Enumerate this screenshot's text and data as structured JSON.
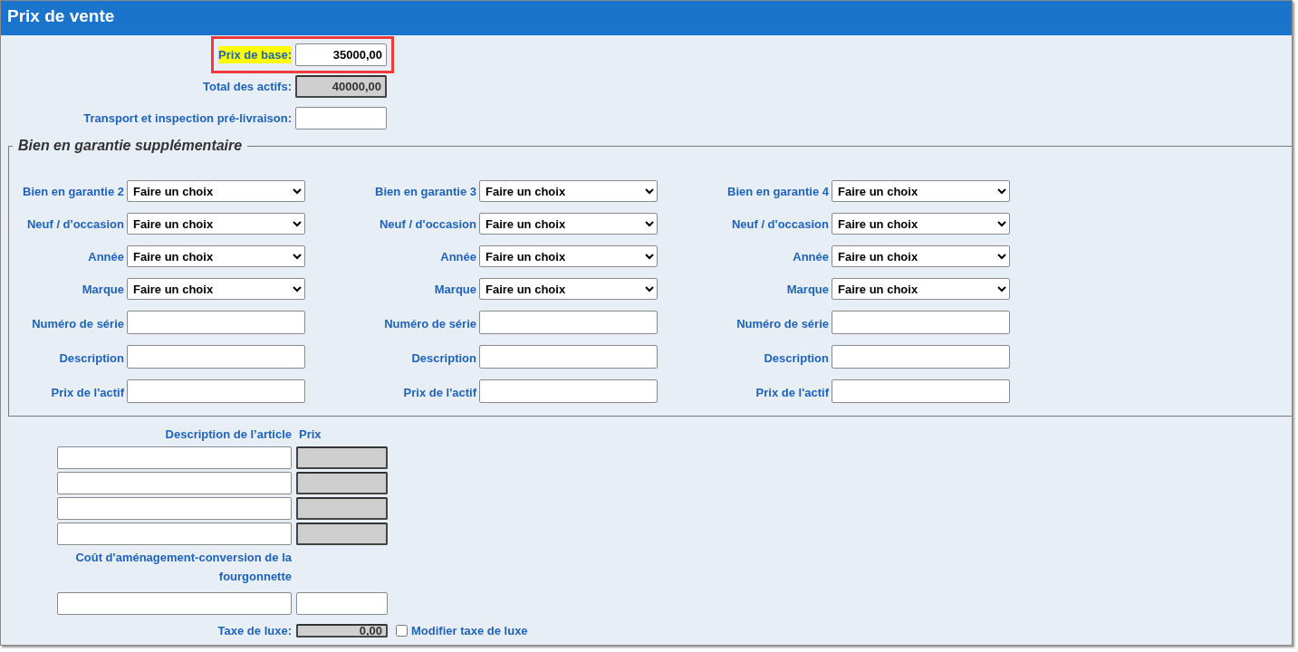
{
  "title": "Prix de vente",
  "fields": [
    {
      "label": "Prix de base:",
      "value": "35000,00",
      "highlighted": true,
      "readonly": false
    },
    {
      "label": "Total des actifs:",
      "value": "40000,00",
      "highlighted": false,
      "readonly": true
    },
    {
      "label": "Transport et inspection pré-livraison:",
      "highlighted": false,
      "readonly": false
    }
  ],
  "collateral": {
    "legend": "Bien en garantie supplémentaire",
    "columns": [
      {
        "rows": [
          {
            "kind": "select",
            "label": "Bien en garantie 2",
            "value": "Faire un choix"
          },
          {
            "kind": "select",
            "label": "Neuf / d'occasion",
            "value": "Faire un choix"
          },
          {
            "kind": "select",
            "label": "Année",
            "value": "Faire un choix"
          },
          {
            "kind": "select",
            "label": "Marque",
            "value": "Faire un choix"
          },
          {
            "kind": "text",
            "label": "Numéro de série"
          },
          {
            "kind": "text",
            "label": "Description"
          },
          {
            "kind": "text",
            "label": "Prix de l'actif"
          }
        ]
      },
      {
        "rows": [
          {
            "kind": "select",
            "label": "Bien en garantie 3",
            "value": "Faire un choix"
          },
          {
            "kind": "select",
            "label": "Neuf / d'occasion",
            "value": "Faire un choix"
          },
          {
            "kind": "select",
            "label": "Année",
            "value": "Faire un choix"
          },
          {
            "kind": "select",
            "label": "Marque",
            "value": "Faire un choix"
          },
          {
            "kind": "text",
            "label": "Numéro de série"
          },
          {
            "kind": "text",
            "label": "Description"
          },
          {
            "kind": "text",
            "label": "Prix de l'actif"
          }
        ]
      },
      {
        "rows": [
          {
            "kind": "select",
            "label": "Bien en garantie 4",
            "value": "Faire un choix"
          },
          {
            "kind": "select",
            "label": "Neuf / d'occasion",
            "value": "Faire un choix"
          },
          {
            "kind": "select",
            "label": "Année",
            "value": "Faire un choix"
          },
          {
            "kind": "select",
            "label": "Marque",
            "value": "Faire un choix"
          },
          {
            "kind": "text",
            "label": "Numéro de série"
          },
          {
            "kind": "text",
            "label": "Description"
          },
          {
            "kind": "text",
            "label": "Prix de l'actif"
          }
        ]
      }
    ]
  },
  "items": {
    "headers": [
      "Description de l’article",
      "Prix"
    ],
    "rows": [
      {
        "price_readonly": true
      },
      {
        "price_readonly": true
      },
      {
        "price_readonly": true
      },
      {
        "price_readonly": true
      }
    ]
  },
  "conversion": {
    "label": "Coût d'aménagement-conversion de la fourgonnette"
  },
  "luxury_tax": {
    "label": "Taxe de luxe:",
    "value": "0,00",
    "readonly": true,
    "override": {
      "label": "Modifier taxe de luxe",
      "checked": false
    }
  }
}
